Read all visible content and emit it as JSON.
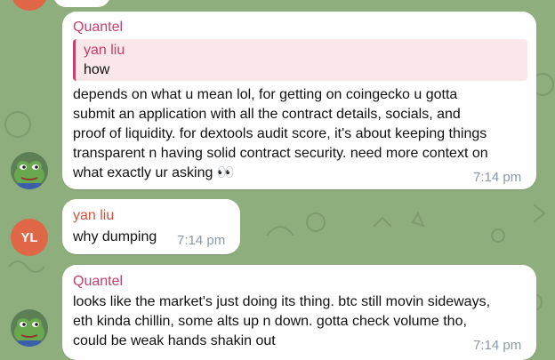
{
  "colors": {
    "background": "#8fae7e",
    "quantel_name": "#c83e6c",
    "yanliu_name": "#d4543b",
    "time": "#8d9aa6",
    "initials_avatar": "#e06648"
  },
  "messages": [
    {
      "sender": "Quantel",
      "avatar_icon": "pepe-frog-avatar-icon",
      "reply": {
        "author": "yan liu",
        "text": "how"
      },
      "lines": [
        "depends on what u mean lol, for getting on coingecko u gotta",
        "submit an application with all the contract details, socials, and",
        "proof of liquidity. for dextools audit score, it's about keeping things",
        "transparent n having solid contract security. need more context on",
        "what exactly ur asking 👀"
      ],
      "time": "7:14 pm"
    },
    {
      "sender": "yan liu",
      "avatar_initials": "YL",
      "lines": [
        "why dumping"
      ],
      "time": "7:14 pm"
    },
    {
      "sender": "Quantel",
      "avatar_icon": "pepe-frog-avatar-icon",
      "lines": [
        "looks like the market's just doing its thing. btc still movin sideways,",
        "eth kinda chillin, some alts up n down. gotta check volume tho,",
        "could be weak hands shakin out"
      ],
      "time": "7:14 pm"
    }
  ]
}
